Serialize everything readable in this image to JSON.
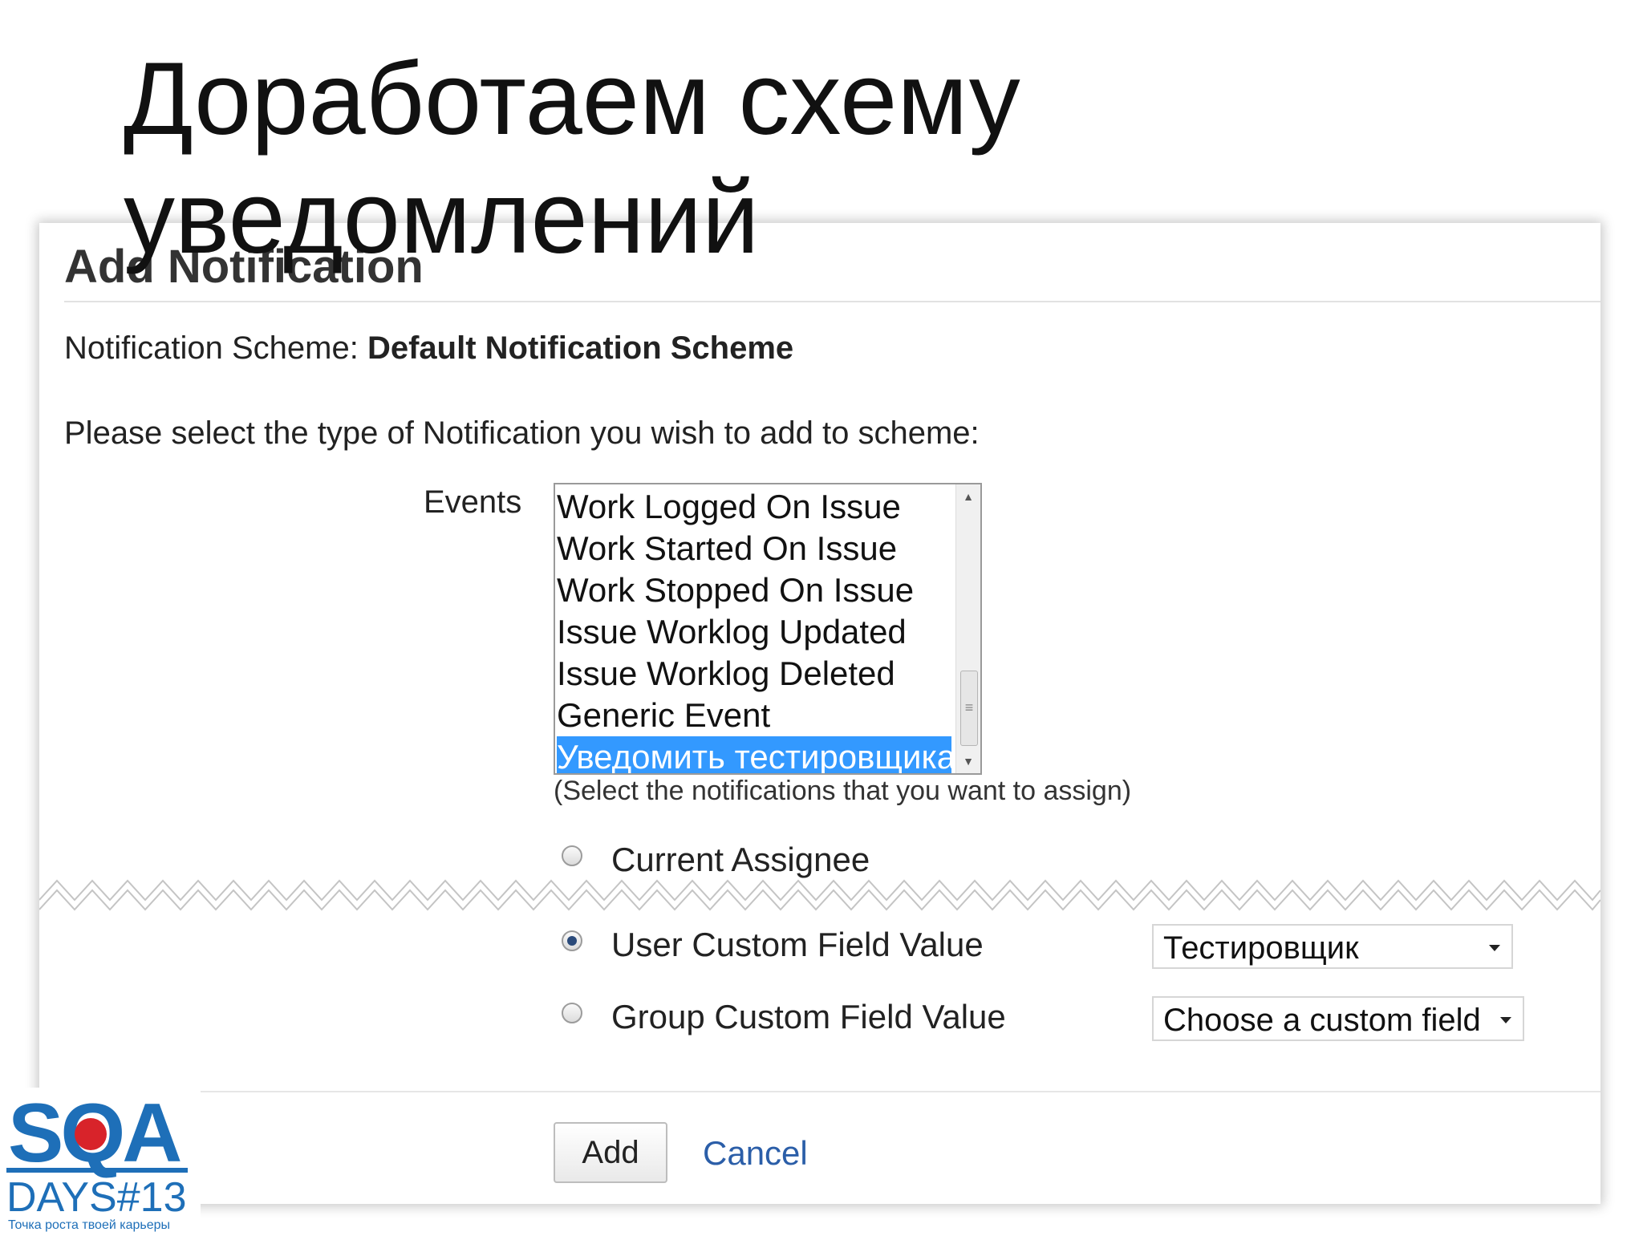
{
  "slide": {
    "title": "Доработаем схему уведомлений"
  },
  "dialog": {
    "heading": "Add Notification",
    "scheme_label": "Notification Scheme:",
    "scheme_name": "Default Notification Scheme",
    "prompt": "Please select the type of Notification you wish to add to scheme:",
    "events_label": "Events",
    "events": [
      {
        "label": "Work Logged On Issue",
        "selected": false
      },
      {
        "label": "Work Started On Issue",
        "selected": false
      },
      {
        "label": "Work Stopped On Issue",
        "selected": false
      },
      {
        "label": "Issue Worklog Updated",
        "selected": false
      },
      {
        "label": "Issue Worklog Deleted",
        "selected": false
      },
      {
        "label": "Generic Event",
        "selected": false
      },
      {
        "label": "Уведомить тестировщика",
        "selected": true
      }
    ],
    "events_hint": "(Select the notifications that you want to assign)",
    "options": {
      "current_assignee": "Current Assignee",
      "user_custom_field": "User Custom Field Value",
      "group_custom_field": "Group Custom Field Value"
    },
    "selected_option": "user_custom_field",
    "user_field_select": "Тестировщик",
    "group_field_select": "Choose a custom field",
    "add_label": "Add",
    "cancel_label": "Cancel"
  },
  "logo": {
    "brand": "SQA",
    "edition": "DAYS#13",
    "tagline": "Точка роста твоей карьеры"
  },
  "colors": {
    "selection": "#3399ff",
    "link": "#2b5ea8",
    "logo_blue": "#1e6fb8",
    "logo_red": "#d8232a"
  }
}
